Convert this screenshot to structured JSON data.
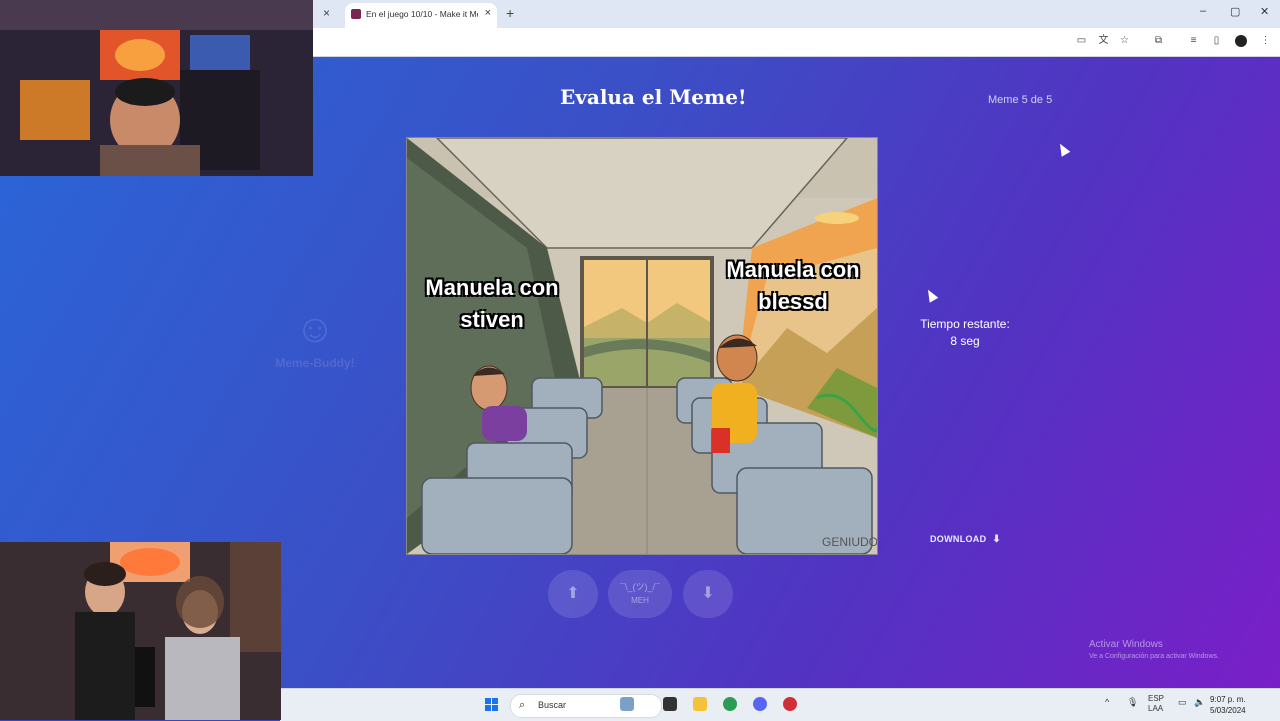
{
  "browser": {
    "tab_title": "En el juego 10/10 - Make it Me",
    "tab_close": "×",
    "prev_tab_close": "×",
    "new_tab": "+",
    "minimize": "–",
    "maximize": "▢",
    "close": "✕"
  },
  "page": {
    "heading": "Evalua el Meme!",
    "counter": "Meme 5 de 5",
    "watermark": "Meme-Buddy!",
    "meme": {
      "caption_left": "Manuela con stiven",
      "caption_right": "Manuela con blessd",
      "signature": "GENIUDO"
    },
    "timer": {
      "label": "Tiempo restante:",
      "value": "8 seg"
    },
    "download": "DOWNLOAD",
    "vote": {
      "up": "⬆",
      "meh_ascii": "¯\\_(ツ)_/¯",
      "meh": "MEH",
      "down": "⬇"
    },
    "activate_windows": {
      "title": "Activar Windows",
      "subtitle": "Ve a Configuración para activar Windows."
    }
  },
  "taskbar": {
    "search_placeholder": "Buscar",
    "lang": "ESP",
    "lang2": "LAA",
    "time": "9:07 p. m.",
    "date": "5/03/2024"
  },
  "colors": {
    "gradient_start": "#2a66d8",
    "gradient_end": "#7a1fc8",
    "accent_purple": "#5233c2"
  }
}
